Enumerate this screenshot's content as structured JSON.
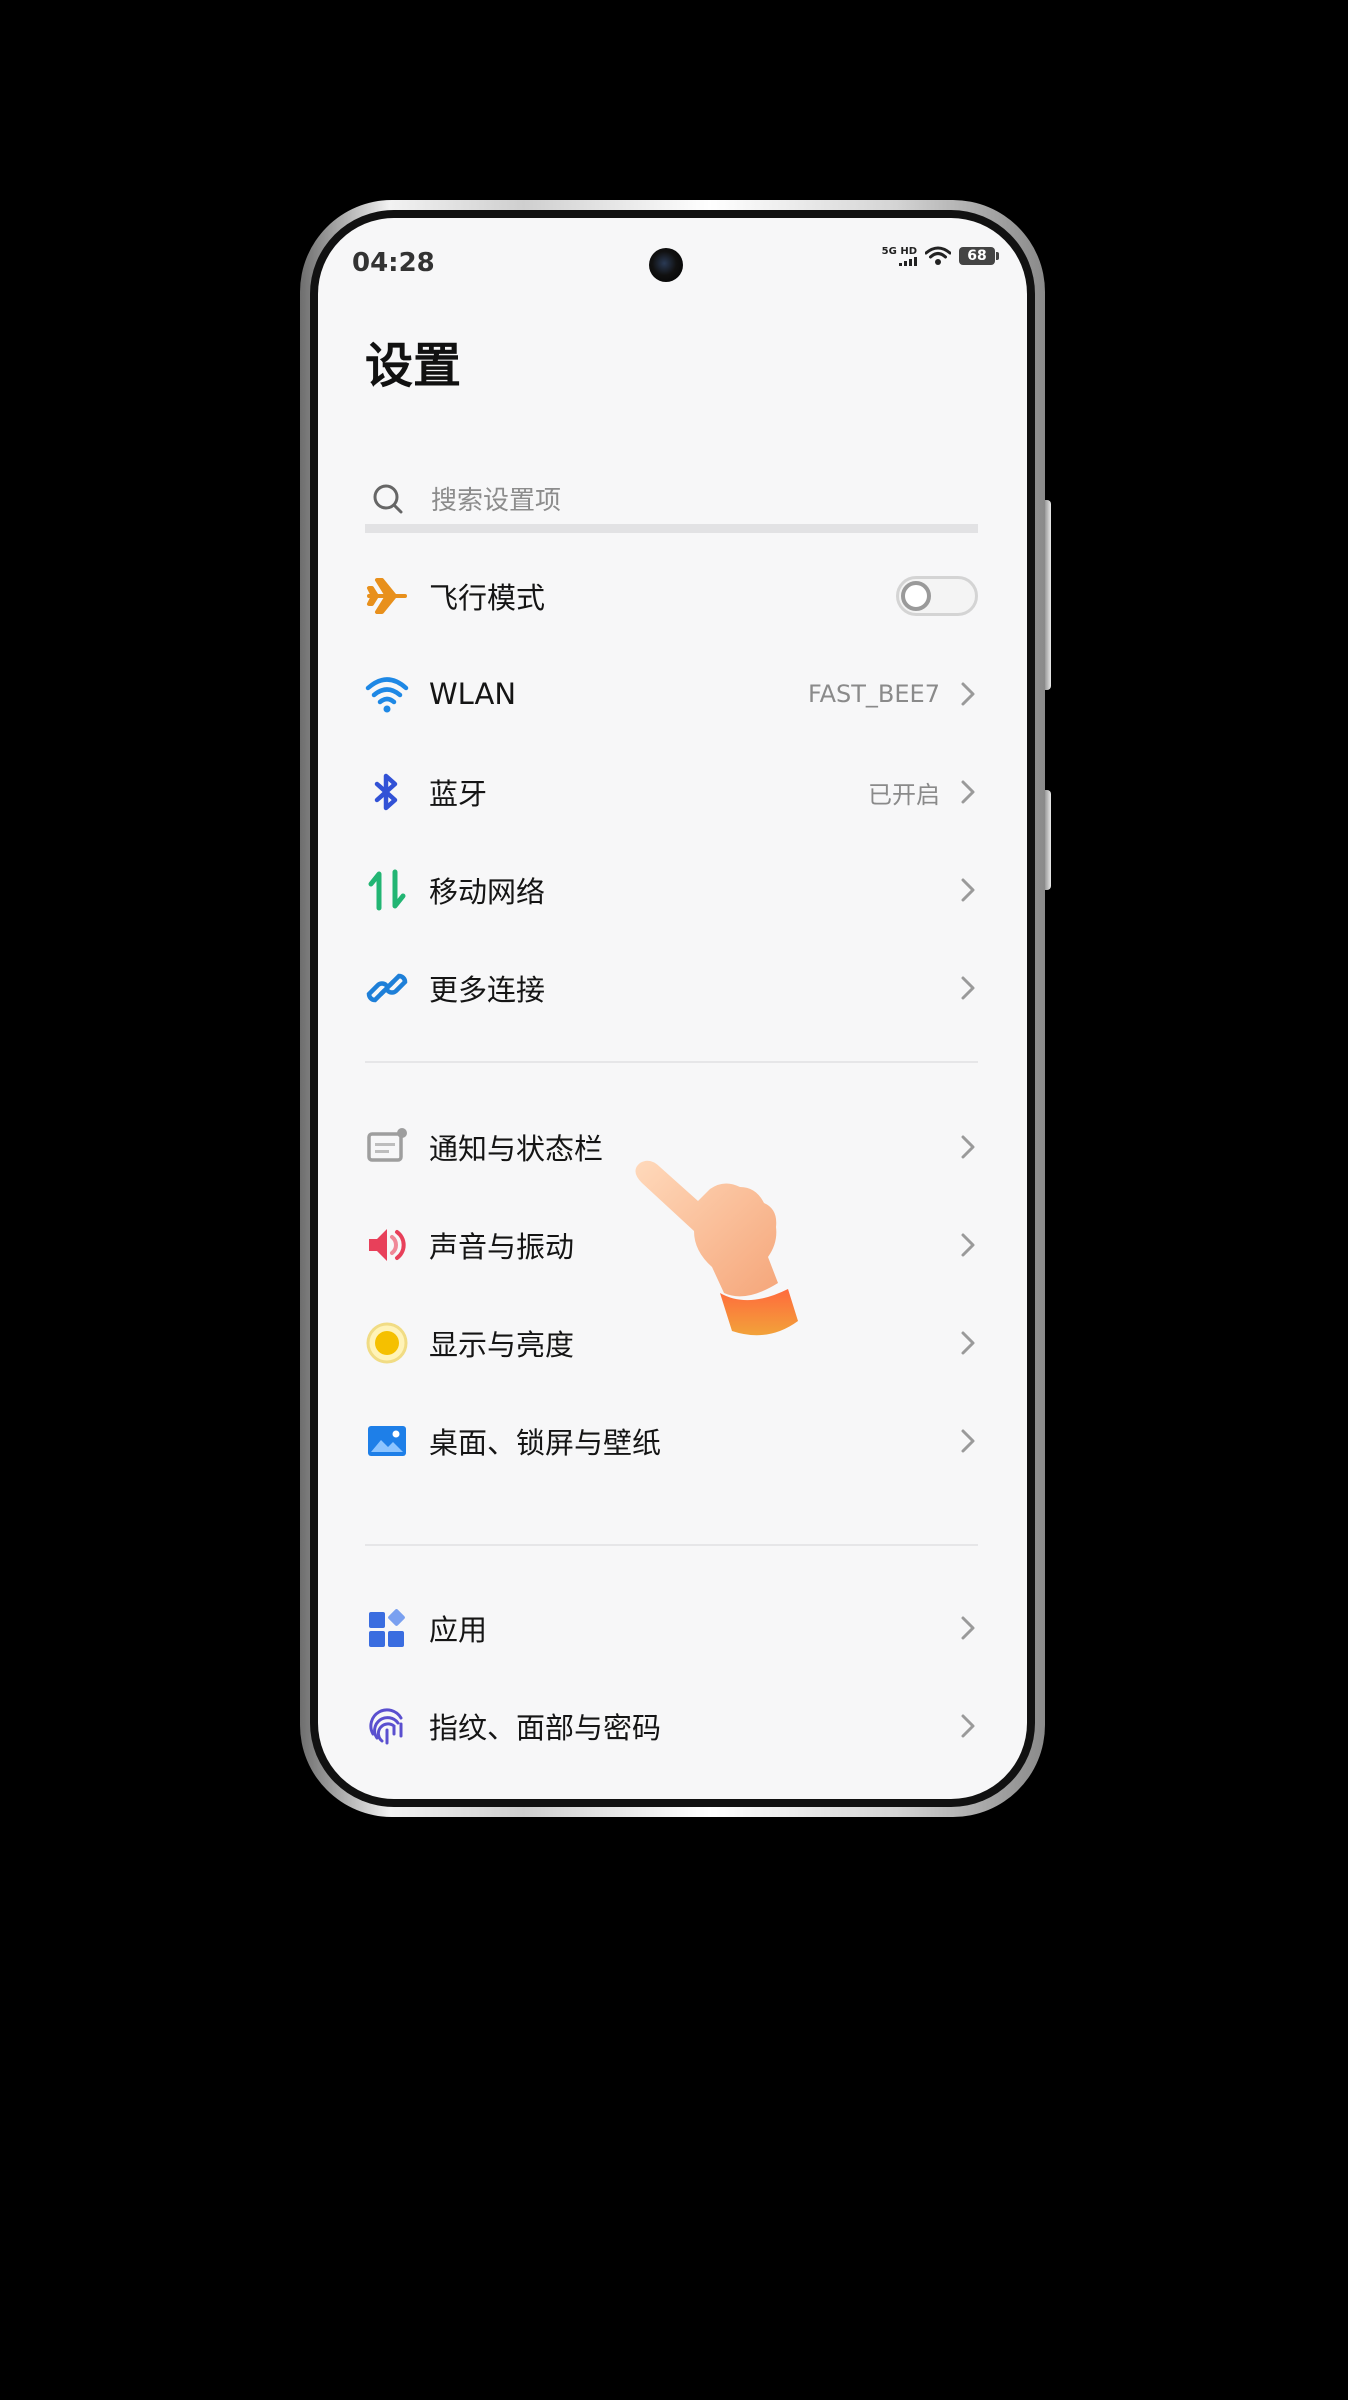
{
  "status_bar": {
    "time": "04:28",
    "network": "5G HD",
    "battery": "68"
  },
  "page": {
    "title": "设置"
  },
  "search": {
    "placeholder": "搜索设置项"
  },
  "items": [
    {
      "label": "飞行模式",
      "value": "",
      "icon": "airplane-icon",
      "control": "toggle",
      "on": false,
      "color": "#e8901c"
    },
    {
      "label": "WLAN",
      "value": "FAST_BEE7",
      "icon": "wifi-icon",
      "control": "chevron",
      "color": "#1e88e5"
    },
    {
      "label": "蓝牙",
      "value": "已开启",
      "icon": "bluetooth-icon",
      "control": "chevron",
      "color": "#3252d6"
    },
    {
      "label": "移动网络",
      "value": "",
      "icon": "mobile-data-icon",
      "control": "chevron",
      "color": "#22b573"
    },
    {
      "label": "更多连接",
      "value": "",
      "icon": "link-icon",
      "control": "chevron",
      "color": "#1e7fd8"
    },
    {
      "label": "通知与状态栏",
      "value": "",
      "icon": "notification-icon",
      "control": "chevron",
      "color": "#9e9e9e"
    },
    {
      "label": "声音与振动",
      "value": "",
      "icon": "speaker-icon",
      "control": "chevron",
      "color": "#e8405a"
    },
    {
      "label": "显示与亮度",
      "value": "",
      "icon": "brightness-icon",
      "control": "chevron",
      "color": "#f5c000"
    },
    {
      "label": "桌面、锁屏与壁纸",
      "value": "",
      "icon": "wallpaper-icon",
      "control": "chevron",
      "color": "#1e7fe8"
    },
    {
      "label": "应用",
      "value": "",
      "icon": "apps-icon",
      "control": "chevron",
      "color": "#3a6de0"
    },
    {
      "label": "指纹、面部与密码",
      "value": "",
      "icon": "fingerprint-icon",
      "control": "chevron",
      "color": "#5a4fcf"
    }
  ]
}
